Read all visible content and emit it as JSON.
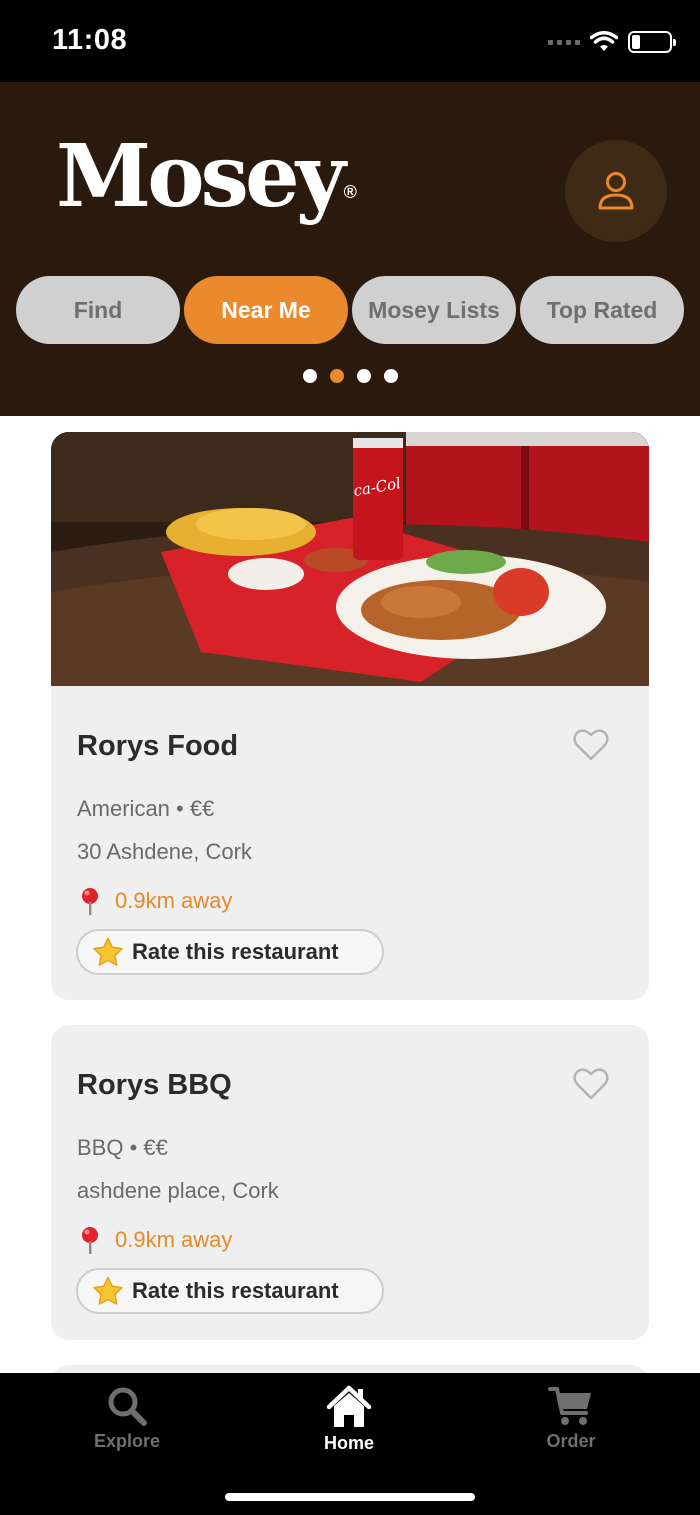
{
  "status_bar": {
    "time": "11:08"
  },
  "header": {
    "logo_text": "Mosey",
    "logo_mark": "®",
    "profile_icon": "person-icon"
  },
  "tabs": [
    {
      "label": "Find",
      "active": false
    },
    {
      "label": "Near Me",
      "active": true
    },
    {
      "label": "Mosey Lists",
      "active": false
    },
    {
      "label": "Top Rated",
      "active": false
    }
  ],
  "pager": {
    "count": 4,
    "active_index": 1
  },
  "restaurants": [
    {
      "name": "Rorys Food",
      "cuisine_price": "American • €€",
      "address": "30 Ashdene, Cork",
      "distance": "0.9km away",
      "rate_label": "Rate this restaurant",
      "has_photo": true
    },
    {
      "name": "Rorys BBQ",
      "cuisine_price": "BBQ • €€",
      "address": "ashdene place, Cork",
      "distance": "0.9km away",
      "rate_label": "Rate this restaurant",
      "has_photo": false
    }
  ],
  "bottom_nav": [
    {
      "label": "Explore",
      "icon": "search-icon",
      "active": false
    },
    {
      "label": "Home",
      "icon": "home-icon",
      "active": true
    },
    {
      "label": "Order",
      "icon": "cart-icon",
      "active": false
    }
  ],
  "colors": {
    "accent": "#ea8a2c",
    "header_bg": "#2a1a0e",
    "card_bg": "#efefef",
    "inactive_tab": "#d0d0d0"
  }
}
